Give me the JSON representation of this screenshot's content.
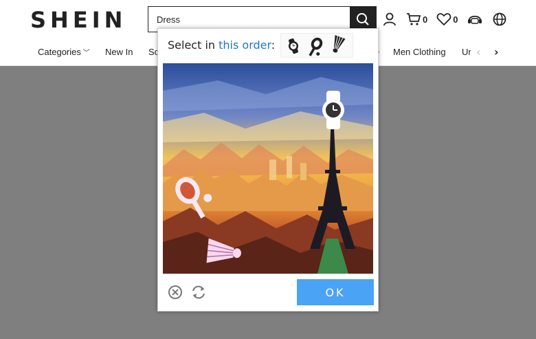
{
  "header": {
    "logo": "SHEIN",
    "search_value": "Dress",
    "cart_count": "0",
    "wishlist_count": "0"
  },
  "nav": {
    "items": [
      "Categories",
      "New In",
      "So",
      "e",
      "Men Clothing",
      "Ur"
    ]
  },
  "captcha": {
    "instruction_prefix": "Select in ",
    "instruction_link": "this order",
    "instruction_suffix": ":",
    "target_icons": [
      "watch-icon",
      "racket-icon",
      "shuttlecock-icon"
    ],
    "ok_label": "OK"
  },
  "colors": {
    "accent": "#1e74d6",
    "ok_button": "#4aa3f5",
    "overlay": "#7f7f7f",
    "dark": "#222222"
  }
}
